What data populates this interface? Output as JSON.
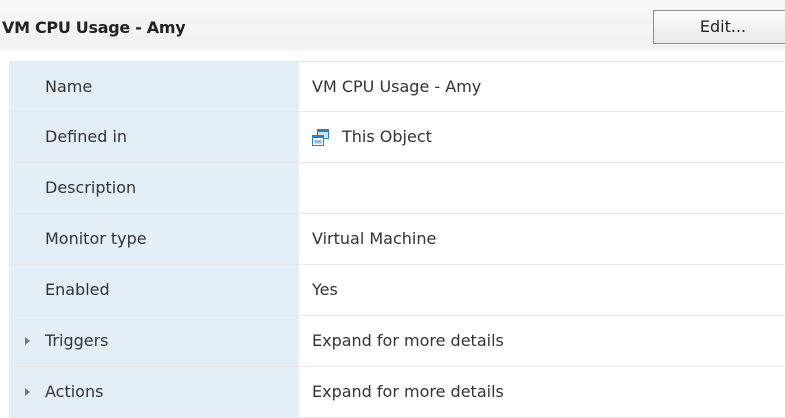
{
  "header": {
    "title": "VM CPU Usage - Amy",
    "edit_label": "Edit..."
  },
  "properties": [
    {
      "label": "Name",
      "value": "VM CPU Usage - Amy"
    },
    {
      "label": "Defined in",
      "value": "This Object",
      "icon": "virtual-machine-object-icon"
    },
    {
      "label": "Description",
      "value": ""
    },
    {
      "label": "Monitor type",
      "value": "Virtual Machine"
    },
    {
      "label": "Enabled",
      "value": "Yes"
    },
    {
      "label": "Triggers",
      "value": "Expand for more details",
      "expandable": true
    },
    {
      "label": "Actions",
      "value": "Expand for more details",
      "expandable": true
    }
  ],
  "colors": {
    "label_background": "#e3eef7",
    "icon_blue": "#2f7bc4"
  }
}
